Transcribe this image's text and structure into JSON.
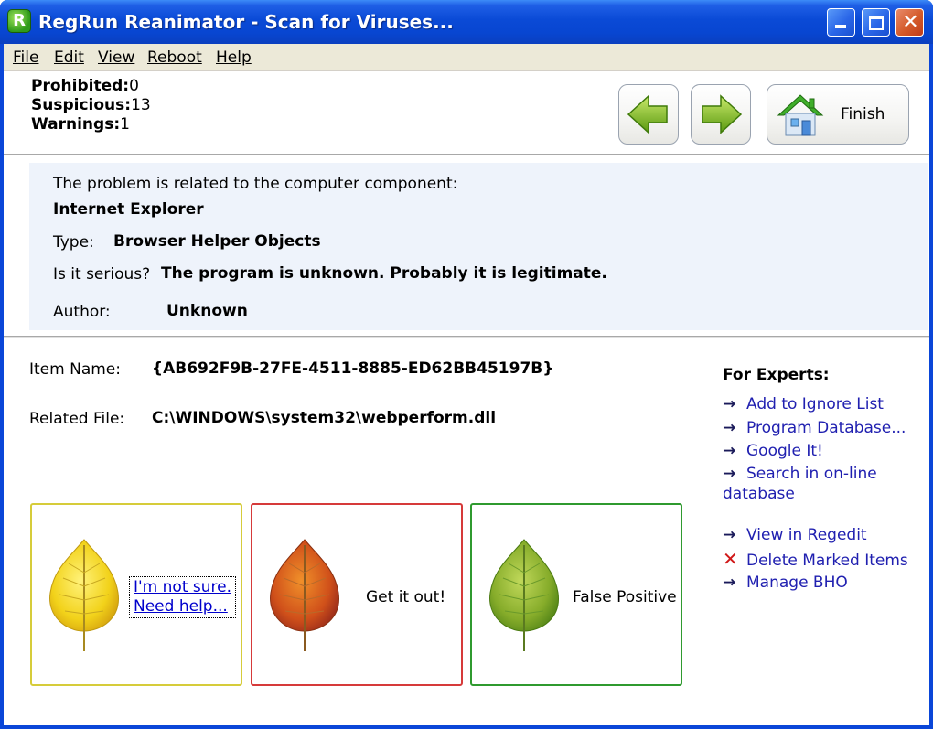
{
  "window": {
    "title": "RegRun Reanimator - Scan for Viruses...",
    "app_icon_letter": "R"
  },
  "menu": {
    "items": [
      {
        "label": "File",
        "underline": "F"
      },
      {
        "label": "Edit",
        "underline": "E"
      },
      {
        "label": "View",
        "underline": "V"
      },
      {
        "label": "Reboot",
        "underline": "R"
      },
      {
        "label": "Help",
        "underline": "H"
      }
    ]
  },
  "summary": {
    "prohibited_label": "Prohibited:",
    "prohibited_value": "0",
    "suspicious_label": "Suspicious:",
    "suspicious_value": "13",
    "warnings_label": "Warnings:",
    "warnings_value": "1"
  },
  "toolbar": {
    "finish_label": "Finish"
  },
  "problem": {
    "intro": "The problem is related to the computer component:",
    "component": "Internet Explorer",
    "type_label": "Type:",
    "type_value": "Browser Helper Objects",
    "serious_label": "Is it serious?",
    "serious_value": "The program is unknown. Probably it is legitimate.",
    "author_label": "Author:",
    "author_value": "Unknown"
  },
  "item": {
    "name_label": "Item Name:",
    "name_value": "{AB692F9B-27FE-4511-8885-ED62BB45197B}",
    "file_label": "Related File:",
    "file_value": "C:\\WINDOWS\\system32\\webperform.dll"
  },
  "choices": {
    "unsure_line1": "I'm not sure.",
    "unsure_line2": "Need help...",
    "get_out": "Get it out!",
    "false_positive": "False Positive"
  },
  "experts": {
    "title": "For Experts:",
    "links": [
      "Add to Ignore List",
      "Program Database...",
      "Google It!",
      "Search in on-line database",
      "View in Regedit",
      "Delete Marked Items",
      "Manage BHO"
    ]
  },
  "colors": {
    "title_blue": "#0a46d8",
    "unsure_border": "#d6cc3a",
    "getout_border": "#d63a3a",
    "false_border": "#2f9a2f",
    "link": "#2020b0"
  }
}
